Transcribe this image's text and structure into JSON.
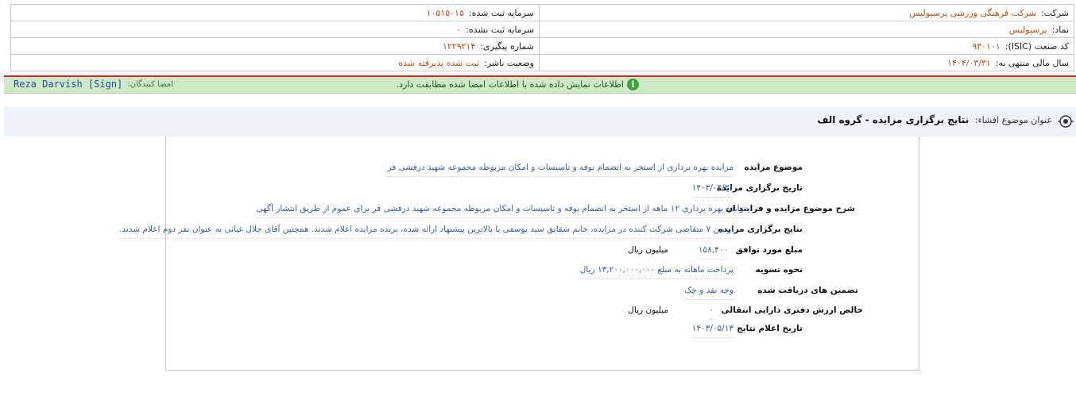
{
  "header": {
    "company_label": "شرکت:",
    "company_value": "شرکت فرهنگی ورزشی پرسپولیس",
    "symbol_label": "نماد:",
    "symbol_value": "پرسپولیس",
    "isic_label": "کد صنعت (ISIC):",
    "isic_value": "۹۳۰۱۰۱",
    "fiscal_label": "سال مالی منتهی به:",
    "fiscal_value": "۱۴۰۴/۰۳/۳۱",
    "registered_capital_label": "سرمایه ثبت شده:",
    "registered_capital_value": "۱۰۵۱۵۰۱۵",
    "unregistered_capital_label": "سرمایه ثبت نشده:",
    "unregistered_capital_value": "۰",
    "tracking_label": "شماره پیگیری:",
    "tracking_value": "۱۲۲۹۲۱۴",
    "publisher_status_label": "وضعیت ناشر:",
    "publisher_status_value": "ثبت شده پذیرفته شده"
  },
  "banner": {
    "message": "اطلاعات نمایش داده شده با اطلاعات امضا شده مطابقت دارد.",
    "signers_label": "امضا کنندگان:",
    "signer_name": "Reza Darvish [Sign]"
  },
  "subject": {
    "label": "عنوان موضوع افشاء:",
    "title": "نتایج برگزاری مزایده - گروه الف"
  },
  "details": {
    "topic_label": "موضوع مزایده",
    "topic_value": "مزایده بهره برداری از استخر به انضمام بوفه و تاسیسات و امکان مربوطه مجموعه شهید درفشی فر",
    "date_label": "تاریخ برگزاری مزایده",
    "date_value": "۱۴۰۳/۰۴/۳۱",
    "process_label": "شرح موضوع مزایده و فرایند ان",
    "process_value": "مزایده بهره برداری ۱۲ ماهه از استخر به انضمام بوفه و تاسیسات و امکان مربوطه مجموعه شهید درفشی فر برای عموم از طریق انتشار آگهی",
    "results_label": "نتایج برگزاری مزایده",
    "results_value": "از بین ۷ متقاضی شرکت کننده در مزایده، خانم شقایق سید یوسفی با بالاترین پیشنهاد ارائه شده، برنده مزایده اعلام شدند. همچنین آقای جلال غیاثی به عنوان نفر دوم اعلام شدند.",
    "amount_label": "مبلغ مورد توافق",
    "amount_value": "۱۵۸,۴۰۰",
    "amount_unit": "میلیون ریال",
    "settlement_label": "نحوه تسویه",
    "settlement_value": "پرداخت ماهانه به مبلغ ۱۳,۲۰۰,۰۰۰,۰۰۰ ریال",
    "guarantees_label": "تضمین های دریافت شده",
    "guarantees_value": "وجه نقد و چک",
    "net_book_label": "خالص ارزش دفتری دارایی انتقالی",
    "net_book_value": "۰",
    "net_book_unit": "میلیون ریال",
    "announce_label": "تاریخ اعلام نتایج",
    "announce_value": "۱۴۰۳/۰۵/۱۳"
  }
}
